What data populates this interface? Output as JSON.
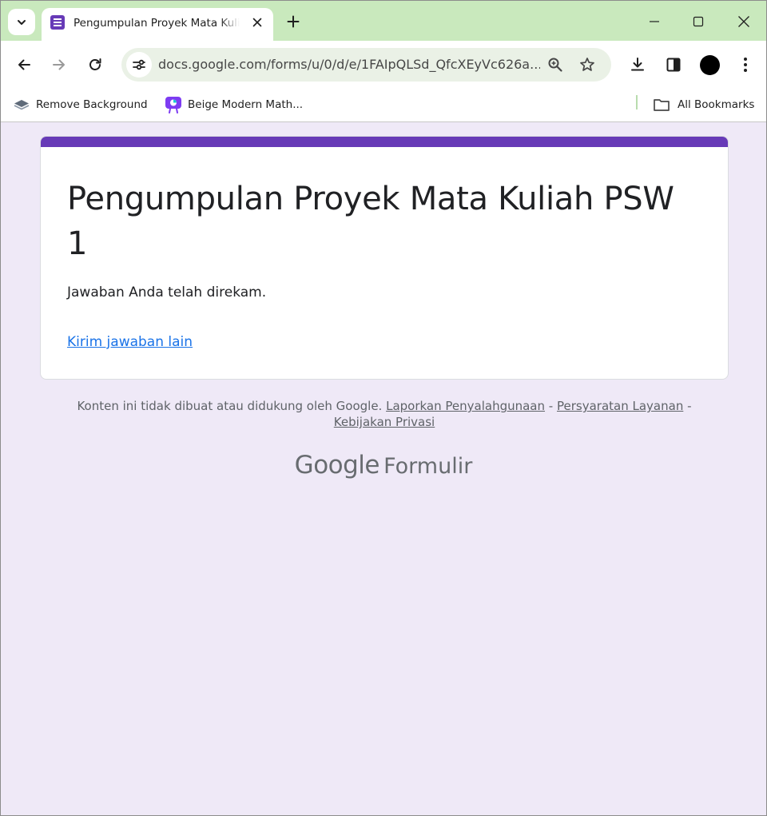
{
  "browser": {
    "tab": {
      "title": "Pengumpulan Proyek Mata Kuliah PSW 1"
    },
    "url": "docs.google.com/forms/u/0/d/e/1FAIpQLSd_QfcXEyVc626a...",
    "bookmarks": [
      {
        "label": "Remove Background",
        "icon": "layers-icon"
      },
      {
        "label": "Beige Modern Math...",
        "icon": "canva-icon"
      }
    ],
    "all_bookmarks_label": "All Bookmarks"
  },
  "form": {
    "title": "Pengumpulan Proyek Mata Kuliah PSW 1",
    "confirmation": "Jawaban Anda telah direkam.",
    "another_response_link": "Kirim jawaban lain"
  },
  "footer": {
    "disclaimer": "Konten ini tidak dibuat atau didukung oleh Google.",
    "report_abuse": "Laporkan Penyalahgunaan",
    "separator": "-",
    "terms": "Persyaratan Layanan",
    "privacy": "Kebijakan Privasi",
    "brand_google": "Google",
    "brand_product": "Formulir"
  },
  "colors": {
    "accent": "#673ab7",
    "page_background": "#efe9f7",
    "titlebar": "#c9e9bd",
    "link": "#1a73e8"
  }
}
